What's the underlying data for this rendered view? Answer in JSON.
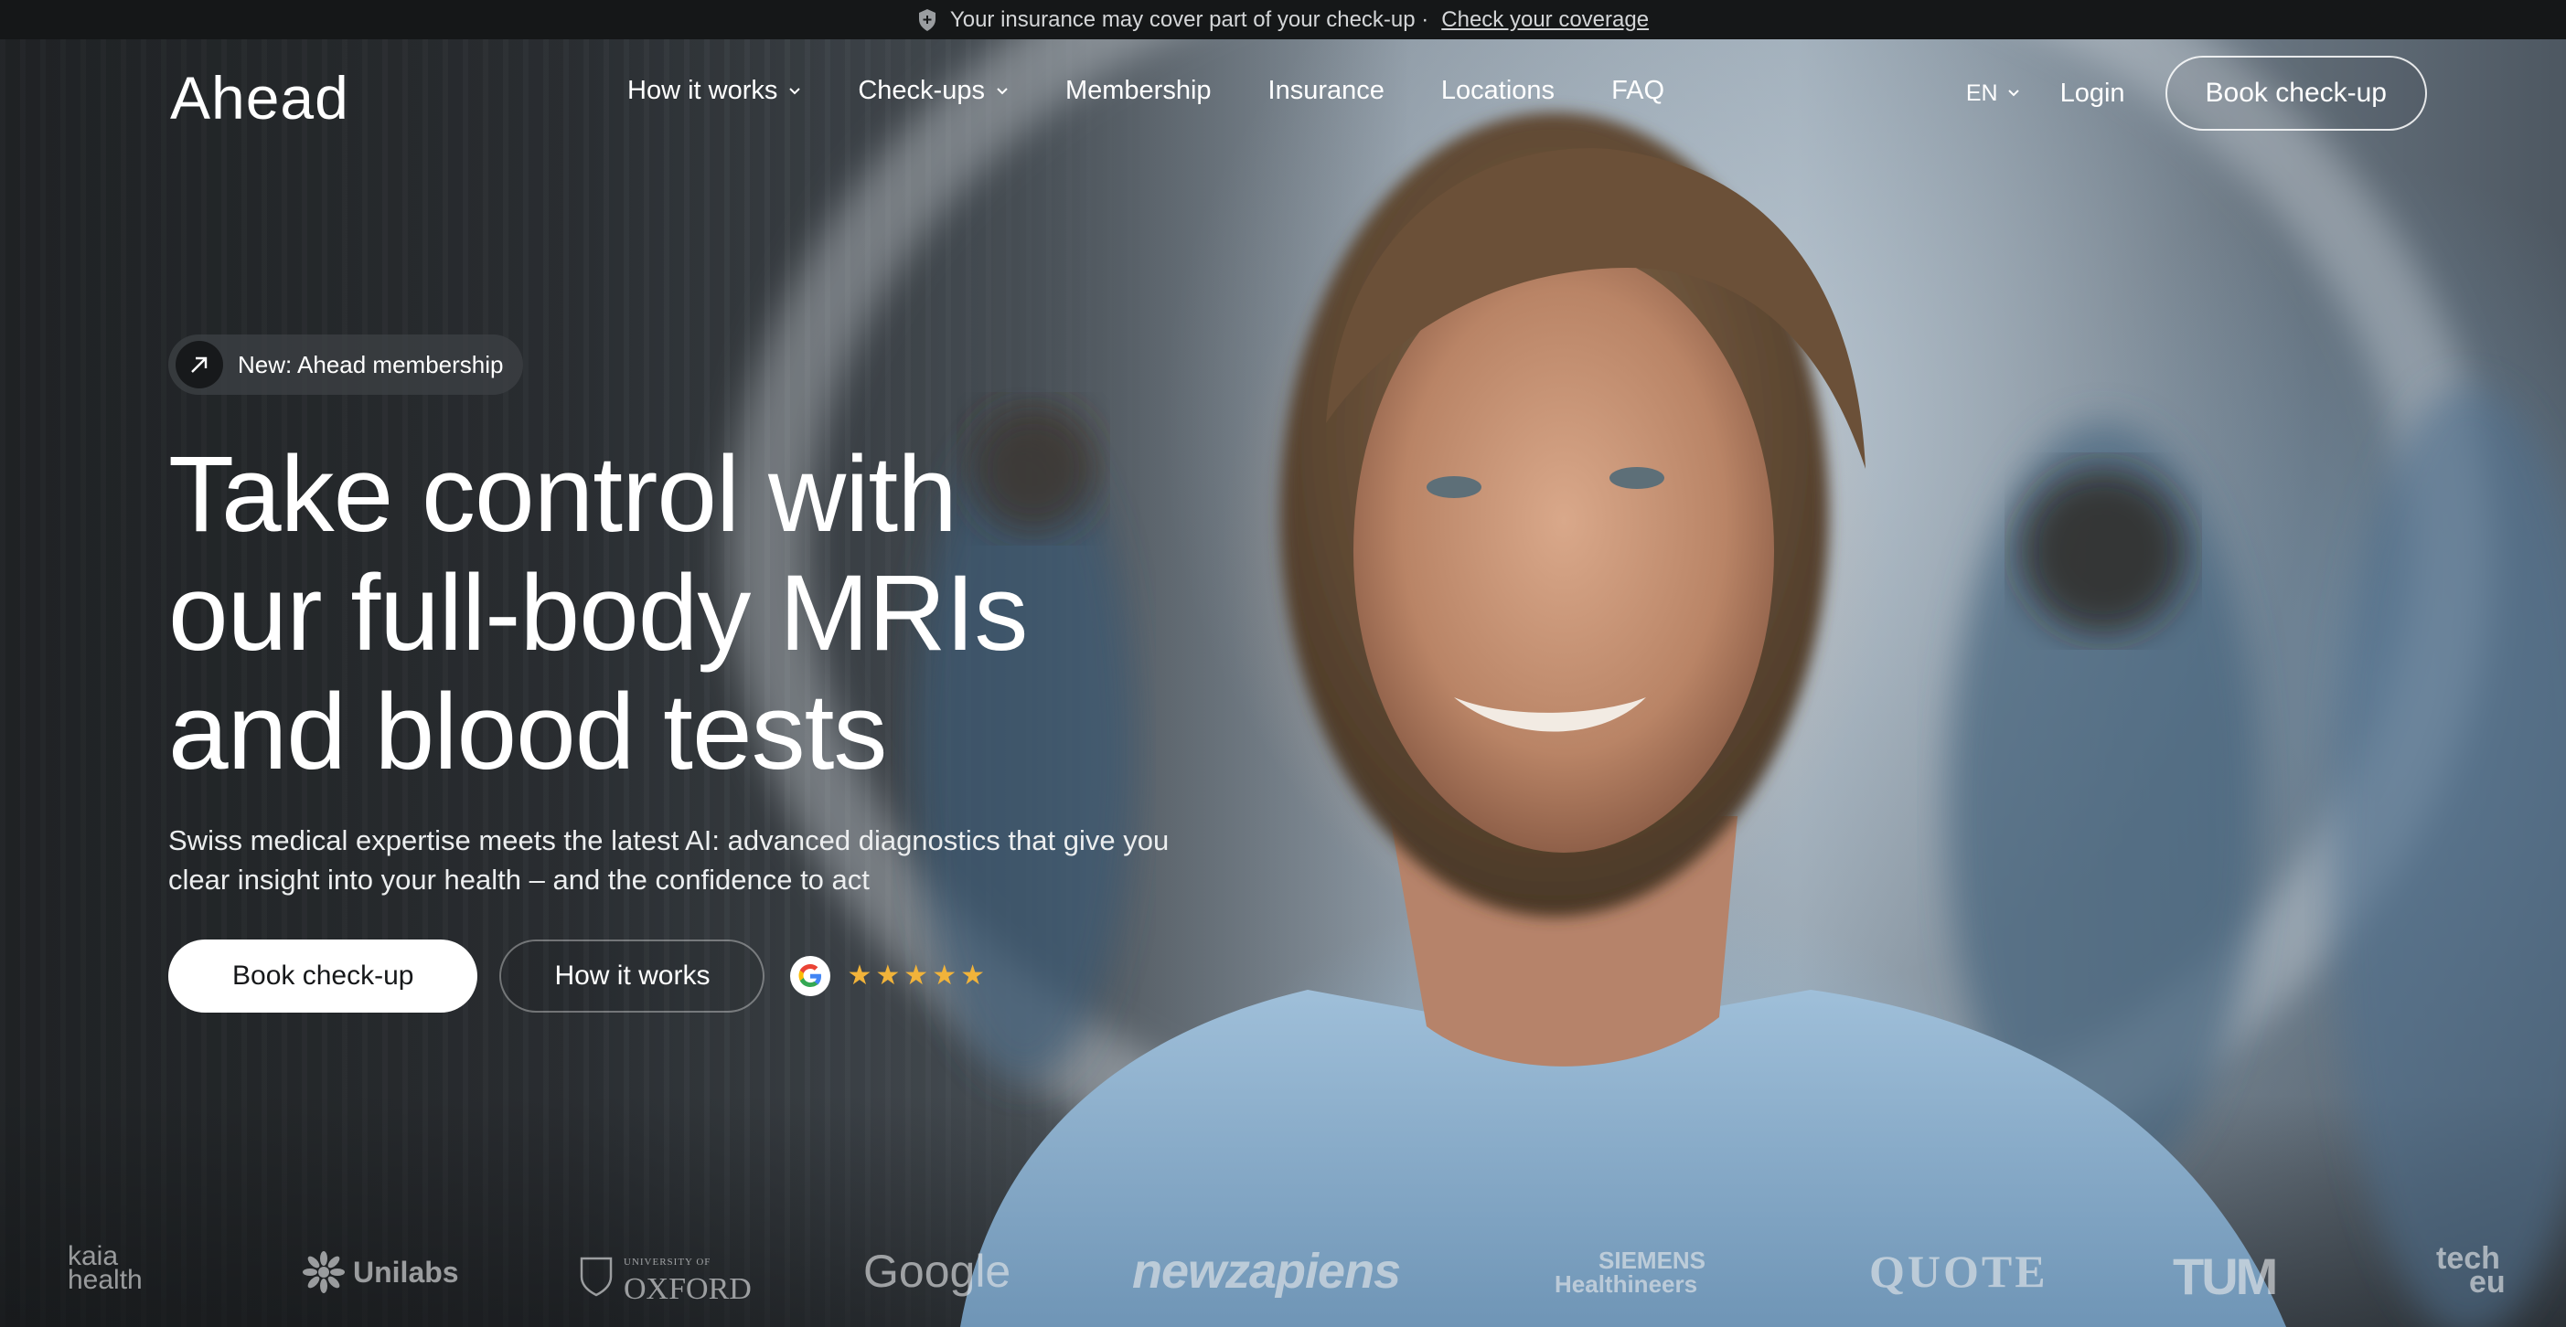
{
  "banner": {
    "text": "Your insurance may cover part of your check-up ·",
    "link": "Check your coverage"
  },
  "nav": {
    "logo": "Ahead",
    "links": [
      {
        "label": "How it works",
        "has_dropdown": true
      },
      {
        "label": "Check-ups",
        "has_dropdown": true
      },
      {
        "label": "Membership",
        "has_dropdown": false
      },
      {
        "label": "Insurance",
        "has_dropdown": false
      },
      {
        "label": "Locations",
        "has_dropdown": false
      },
      {
        "label": "FAQ",
        "has_dropdown": false
      }
    ],
    "language": "EN",
    "login": "Login",
    "book": "Book check-up"
  },
  "hero": {
    "pill": "New: Ahead membership",
    "headline_lines": [
      "Take control with",
      "our full-body MRIs",
      "and blood tests"
    ],
    "subtitle": "Swiss medical expertise meets the latest AI: advanced diagnostics that give you clear insight into your health – and the confidence to act",
    "cta_primary": "Book check-up",
    "cta_secondary": "How it works",
    "rating": {
      "source_icon": "google-icon",
      "stars": 5,
      "max": 5
    }
  },
  "logos": [
    {
      "id": "kaia",
      "line1": "kaia",
      "line2": "health"
    },
    {
      "id": "unilabs",
      "text": "Unilabs"
    },
    {
      "id": "oxford",
      "small": "UNIVERSITY OF",
      "text": "OXFORD"
    },
    {
      "id": "google",
      "text": "Google"
    },
    {
      "id": "newzapiens",
      "text": "newzapiens"
    },
    {
      "id": "siemens",
      "line1": "SIEMENS",
      "line2": "Healthineers"
    },
    {
      "id": "quote",
      "text": "QUOTE"
    },
    {
      "id": "tum",
      "text": "TUM"
    },
    {
      "id": "techeu",
      "line1": "tech",
      "line2": "eu"
    }
  ],
  "colors": {
    "banner_bg": "#151718",
    "star": "#f1b33a",
    "primary_button_bg": "#ffffff",
    "primary_button_text": "#16181a"
  }
}
